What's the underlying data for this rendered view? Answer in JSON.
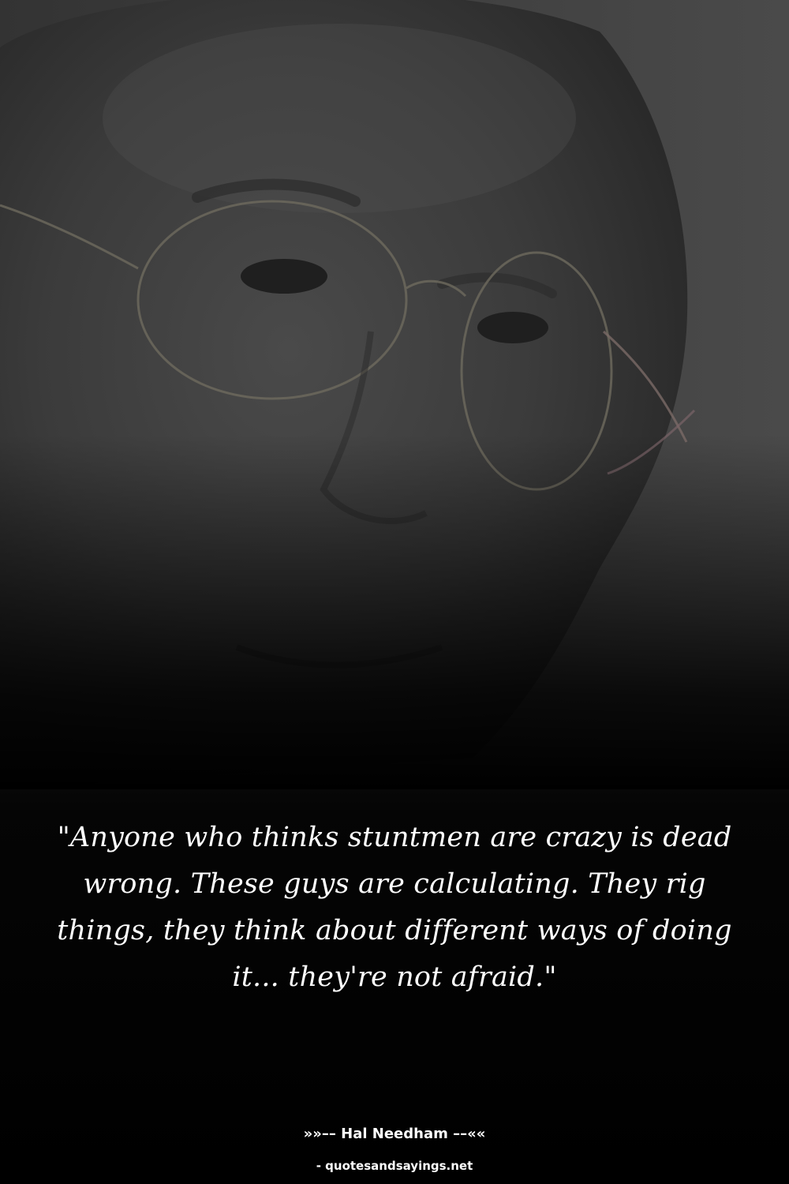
{
  "quote": {
    "text": "\"Anyone who thinks stuntmen are crazy is dead wrong. These guys are calculating. They rig things, they think about different ways of doing it... they're not afraid.\""
  },
  "author": {
    "line": "»»–– Hal Needham ––««"
  },
  "source": {
    "label": "- quotesandsayings.net"
  },
  "colors": {
    "background": "#000000",
    "text": "#ffffff"
  }
}
